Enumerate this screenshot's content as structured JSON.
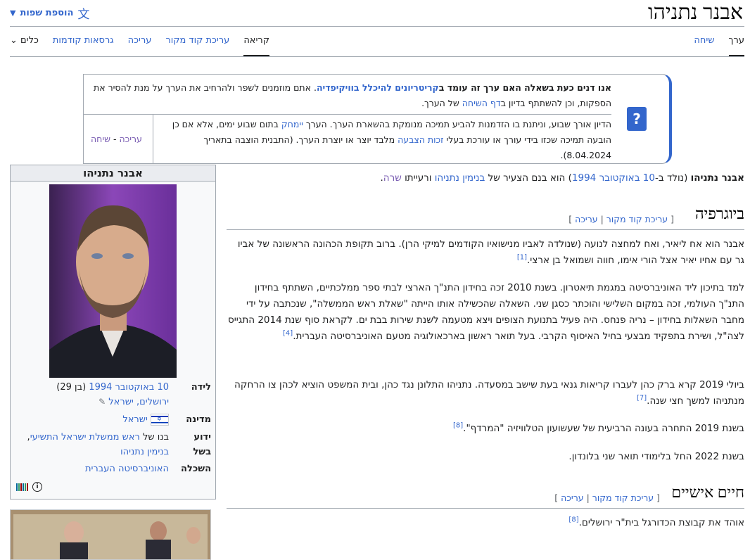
{
  "header": {
    "title": "אבנר נתניהו",
    "add_languages": "הוספת שפות"
  },
  "tabs_right": [
    "ערך",
    "שיחה"
  ],
  "tabs_left": [
    "קריאה",
    "עריכת קוד מקור",
    "עריכה",
    "גרסאות קודמות",
    "כלים"
  ],
  "notice": {
    "line1_bold": "אנו דנים כעת בשאלה האם ערך זה עומד ב",
    "line1_link": "קריטריונים להיכלל בוויקיפדיה",
    "line1_rest": ". אתם מוזמנים לשפר ולהרחיב את הערך על מנת להסיר את הספקות, וכן להשתתף בדיון ב",
    "line1_link2": "דף השיחה",
    "line1_end": " של הערך.",
    "line2a": "הדיון אורך שבוע, וניתנת בו הזדמנות להביע תמיכה מנומקת בהשארת הערך. הערך ",
    "line2_link": "יימחק",
    "line2b": " בתום שבוע ימים, אלא אם כן הובעה תמיכה שכזו בידי עורך או עורכת בעלי ",
    "line2_link2": "זכות הצבעה",
    "line2c": " מלבד יוצר או יוצרת הערך. (התבנית הוצבה בתאריך 8.04.2024).",
    "edit": "עריכה",
    "talk": "שיחה",
    "icon": "?"
  },
  "infobox": {
    "title": "אבנר נתניהו",
    "rows": [
      {
        "label": "לידה",
        "value_link": "10 באוקטובר 1994",
        "value_rest": " (בן 29)",
        "value2": "ירושלים, ישראל"
      },
      {
        "label": "מדינה",
        "value_link": "ישראל"
      },
      {
        "label": "ידוע בשל",
        "value_pre": "בנו של ",
        "value_link": "ראש ממשלת ישראל התשיעי",
        "value_rest": ",",
        "value2": "בנימין נתניהו"
      },
      {
        "label": "השכלה",
        "value_link": "האוניברסיטה העברית"
      }
    ]
  },
  "article": {
    "lead_bold": "אבנר נתניהו",
    "lead_a": " (נולד ב-",
    "lead_link1": "10 באוקטובר",
    "lead_link2": "1994",
    "lead_b": ") הוא בנם הצעיר של ",
    "lead_link3": "בנימין נתניהו",
    "lead_c": " ורעייתו ",
    "lead_link4": "שרה",
    "lead_d": ".",
    "sec1_title": "ביוגרפיה",
    "edit_src": "עריכת קוד מקור",
    "edit": "עריכה",
    "sec2_title": "חיים אישיים",
    "p1": "אבנר הוא אח ליאיר, ואח למחצה לנועה (שנולדה לאביו מנישואיו הקודמים למיקי הרן). ברוב תקופת הכהונה הראשונה של אביו גר עם אחיו יאיר אצל הורי אימו, חווה ושמואל בן ארצי.",
    "p2": "למד בתיכון ליד האוניברסיטה במגמת תיאטרון. בשנת 2010 זכה בחידון התנ\"ך הארצי לבתי ספר ממלכתיים, השתתף בחידון התנ\"ך העולמי, זכה במקום השלישי והוכתר כסגן שני. השאלה שהכשילה אותו הייתה \"שאלת ראש הממשלה\", שנכתבה על ידי מחבר השאלות בחידון – נריה פנחס. היה פעיל בתנועת הצופים ויצא מטעמה לשנת שירות בבת ים. לקראת סוף שנת 2014 התגייס לצה\"ל, ושירת בתפקיד מבצעי בחיל האיסוף הקרבי. בעל תואר ראשון בארכאולוגיה מטעם האוניברסיטה העברית.",
    "p3": "ביולי 2019 קרא ברק כהן לעברו קריאות גנאי בעת שישב במסעדה. נתניהו התלונן נגד כהן, ובית המשפט הוציא לכהן צו הרחקה מנתניהו למשך חצי שנה.",
    "p4": "בשנת 2019 התחרה בעונה הרביעית של שעשועון הטלוויזיה \"המרדף\".",
    "p5": "בשנת 2022 החל בלימודי תואר שני בלונדון.",
    "p6": "אוהד את קבוצת הכדורגל בית\"ר ירושלים."
  },
  "colors": {
    "link": "#3366cc",
    "visited": "#795cb2",
    "border": "#a2a9b1",
    "notice_accent": "#3366cc"
  }
}
